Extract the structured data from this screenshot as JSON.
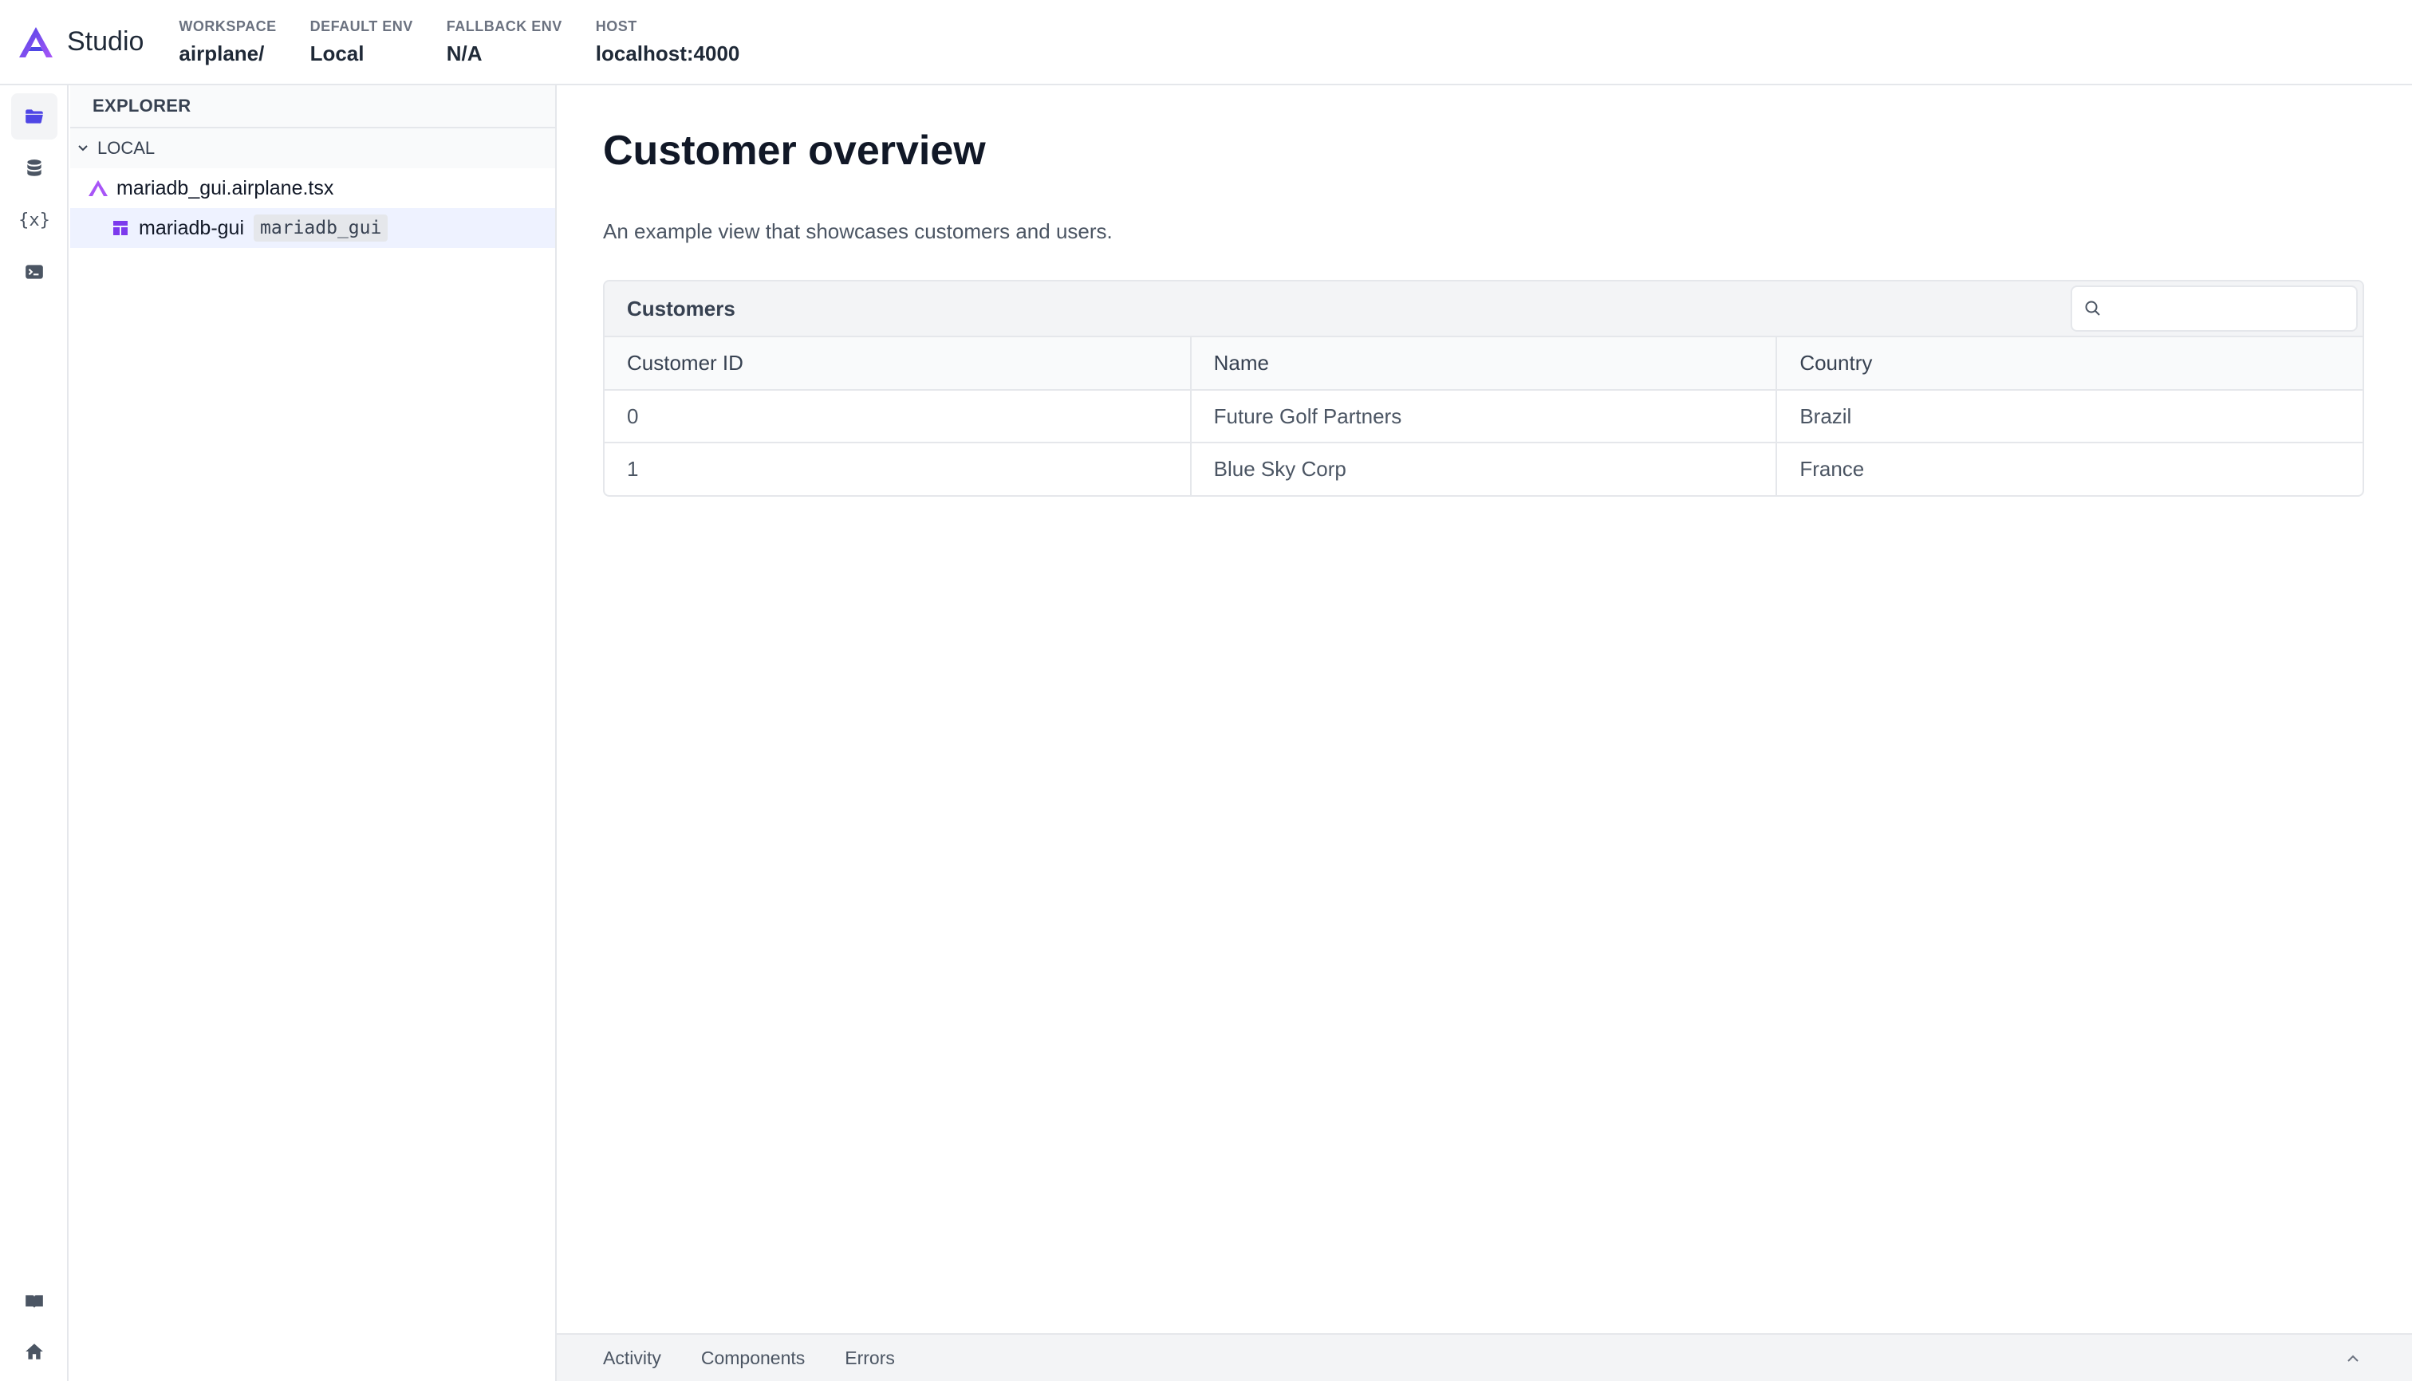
{
  "header": {
    "app_name": "Studio",
    "meta": [
      {
        "label": "WORKSPACE",
        "value": "airplane/"
      },
      {
        "label": "DEFAULT ENV",
        "value": "Local"
      },
      {
        "label": "FALLBACK ENV",
        "value": "N/A"
      },
      {
        "label": "HOST",
        "value": "localhost:4000"
      }
    ]
  },
  "rail": {
    "items": [
      {
        "icon": "folder-icon",
        "active": true
      },
      {
        "icon": "database-icon",
        "active": false
      },
      {
        "icon": "variable-icon",
        "text": "{x}",
        "active": false
      },
      {
        "icon": "terminal-icon",
        "active": false
      },
      {
        "icon": "book-icon",
        "active": false
      },
      {
        "icon": "home-icon",
        "active": false
      }
    ]
  },
  "explorer": {
    "title": "EXPLORER",
    "section": "LOCAL",
    "file": "mariadb_gui.airplane.tsx",
    "view_name": "mariadb-gui",
    "view_slug": "mariadb_gui"
  },
  "main": {
    "title": "Customer overview",
    "description": "An example view that showcases customers and users.",
    "table": {
      "title": "Customers",
      "search_placeholder": "",
      "columns": [
        "Customer ID",
        "Name",
        "Country"
      ],
      "rows": [
        [
          "0",
          "Future Golf Partners",
          "Brazil"
        ],
        [
          "1",
          "Blue Sky Corp",
          "France"
        ]
      ]
    }
  },
  "bottom_bar": {
    "tabs": [
      "Activity",
      "Components",
      "Errors"
    ]
  },
  "colors": {
    "accent": "#4f46e5",
    "brand_purple": "#7c3aed",
    "selected_row": "#eef2ff"
  }
}
